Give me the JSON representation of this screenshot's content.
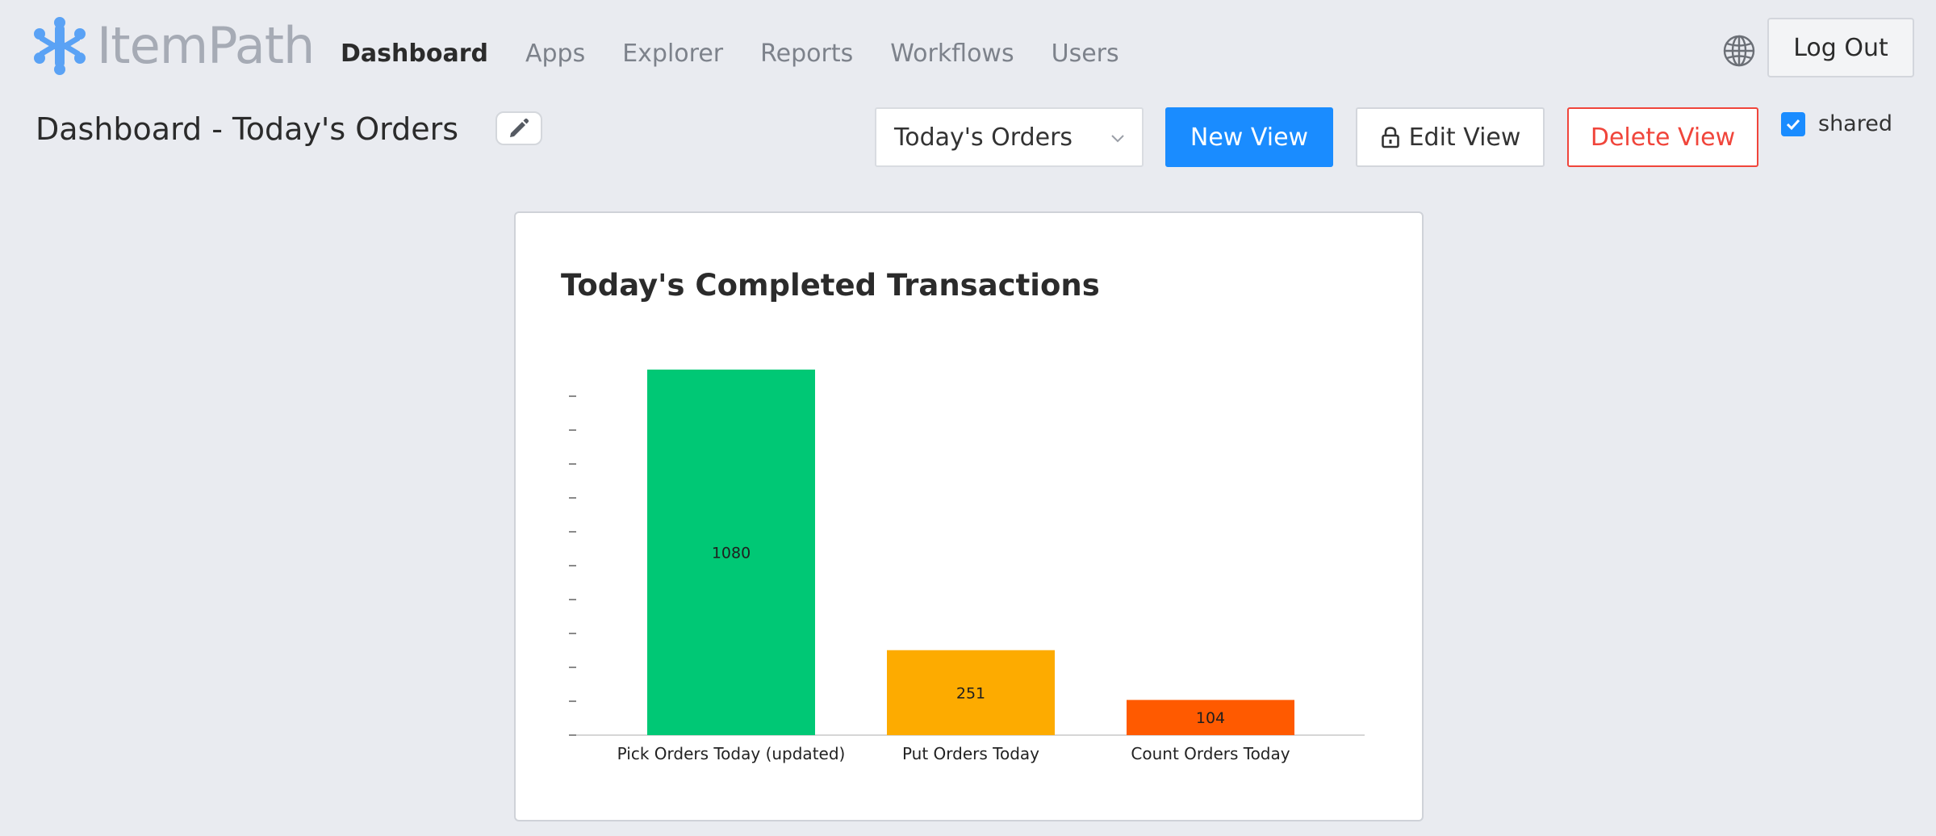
{
  "app": {
    "logo_text": "ItemPath"
  },
  "nav": {
    "items": [
      {
        "label": "Dashboard",
        "active": true
      },
      {
        "label": "Apps"
      },
      {
        "label": "Explorer"
      },
      {
        "label": "Reports"
      },
      {
        "label": "Workflows"
      },
      {
        "label": "Users"
      }
    ],
    "logout_label": "Log Out",
    "globe_icon": "globe-icon"
  },
  "toolbar": {
    "page_title": "Dashboard - Today's Orders",
    "edit_title_icon": "pencil-icon",
    "view_select_value": "Today's Orders",
    "new_view_label": "New View",
    "edit_view_label": "Edit View",
    "edit_view_icon": "lock-icon",
    "delete_view_label": "Delete View",
    "shared_label": "shared",
    "shared_checked": true
  },
  "colors": {
    "primary": "#1a8cff",
    "danger": "#f0453b"
  },
  "chart_data": {
    "type": "bar",
    "title": "Today's Completed Transactions",
    "categories": [
      "Pick Orders Today (updated)",
      "Put Orders Today",
      "Count Orders Today"
    ],
    "values": [
      1080,
      251,
      104
    ],
    "colors": [
      "#00c875",
      "#fdab00",
      "#ff5a00"
    ],
    "ylim": [
      0,
      1080
    ],
    "y_ticks_labeled": false,
    "grid": false,
    "legend": "none"
  }
}
